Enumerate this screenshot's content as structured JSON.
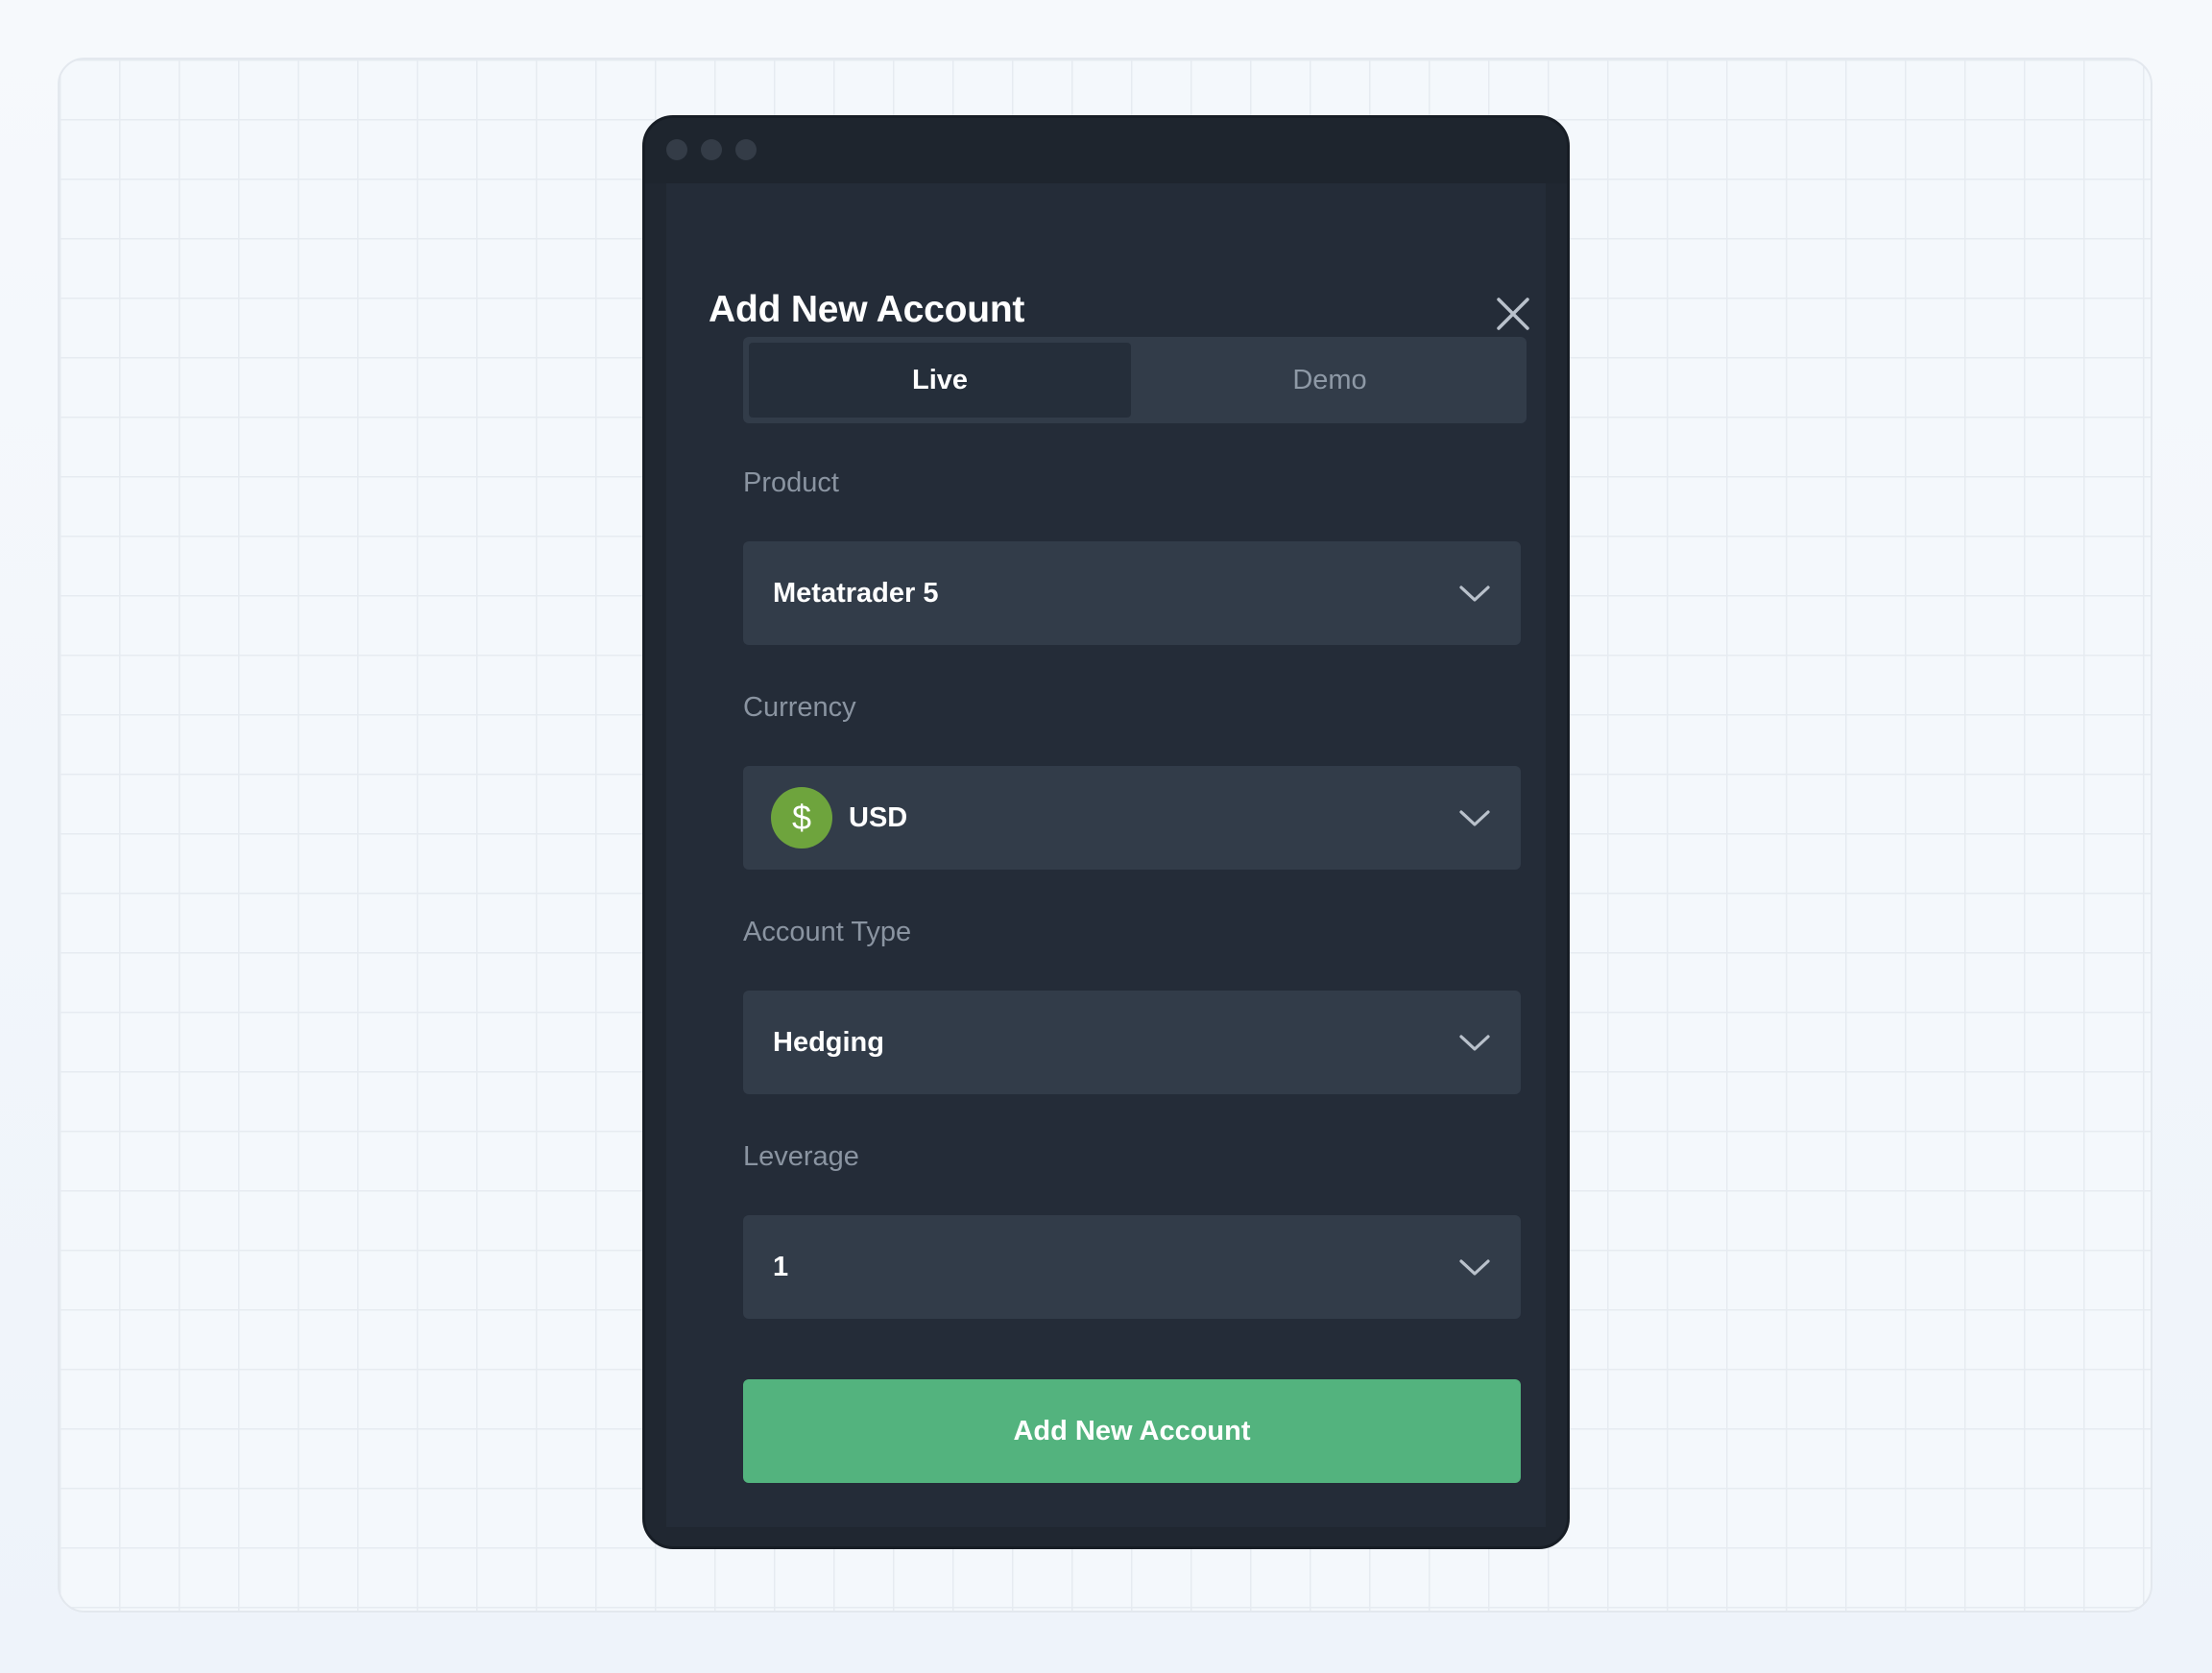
{
  "dialog": {
    "title": "Add New Account",
    "close_icon": "close-icon"
  },
  "tabs": {
    "live": "Live",
    "demo": "Demo",
    "active": "Live"
  },
  "fields": {
    "product": {
      "label": "Product",
      "value": "Metatrader 5"
    },
    "currency": {
      "label": "Currency",
      "value": "USD",
      "icon": "dollar-icon",
      "icon_glyph": "$",
      "icon_color": "#6ea43d"
    },
    "account_type": {
      "label": "Account Type",
      "value": "Hedging"
    },
    "leverage": {
      "label": "Leverage",
      "value": "1"
    }
  },
  "submit": {
    "label": "Add New Account",
    "color": "#53b37e"
  },
  "theme": {
    "panel_bg": "#242c38",
    "field_bg": "#323c49",
    "label_color": "#8a94a1"
  }
}
